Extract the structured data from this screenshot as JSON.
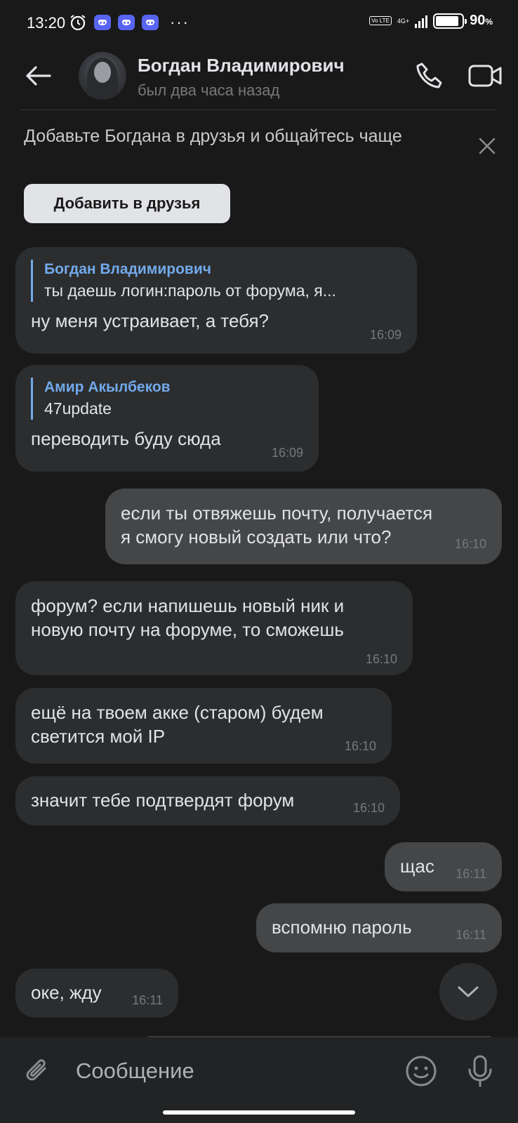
{
  "status_bar": {
    "time": "13:20",
    "battery_percent_label": "90",
    "battery_percent_sign": "%",
    "battery_level": 0.9,
    "network_label": "4G+",
    "volte_label": "Vo LTE",
    "icons": [
      "alarm-icon",
      "discord-icon",
      "discord-icon",
      "discord-icon",
      "more-dots-icon",
      "signal-icon",
      "battery-icon"
    ]
  },
  "header": {
    "contact_name": "Богдан Владимирович",
    "last_seen": "был два часа назад",
    "icons": [
      "back-arrow-icon",
      "phone-icon",
      "video-camera-icon"
    ]
  },
  "banner": {
    "text": "Добавьте Богдана в друзья и общайтесь чаще",
    "button_label": "Добавить в друзья"
  },
  "messages": [
    {
      "direction": "in",
      "reply_to": {
        "name": "Богдан Владимирович",
        "text": "ты даешь логин:пароль от форума, я..."
      },
      "text": "ну меня устраивает, а тебя?",
      "time": "16:09"
    },
    {
      "direction": "in",
      "reply_to": {
        "name": "Амир Акылбеков",
        "text": "47update"
      },
      "text": "переводить буду сюда",
      "time": "16:09"
    },
    {
      "direction": "out",
      "lines": [
        "если ты отвяжешь почту, получается",
        "я смогу новый создать или что?"
      ],
      "time": "16:10"
    },
    {
      "direction": "in",
      "lines": [
        "форум? если напишешь новый ник и",
        "новую почту на форуме, то сможешь"
      ],
      "time": "16:10"
    },
    {
      "direction": "in",
      "lines": [
        "ещё на твоем акке (старом) будем",
        "светится мой IP"
      ],
      "time": "16:10"
    },
    {
      "direction": "in",
      "text": "значит тебе подтвердят форум",
      "time": "16:10"
    },
    {
      "direction": "out",
      "text": "щас",
      "time": "16:11"
    },
    {
      "direction": "out",
      "text": "вспомню пароль",
      "time": "16:11"
    },
    {
      "direction": "in",
      "text": "оке, жду",
      "time": "16:11"
    }
  ],
  "composer": {
    "placeholder": "Сообщение",
    "icons": [
      "paperclip-icon",
      "emoji-icon",
      "microphone-icon"
    ]
  },
  "colors": {
    "background": "#19191a",
    "incoming_bubble": "#2c2d2e",
    "outgoing_bubble": "#454647",
    "accent": "#71aaeb",
    "discord": "#5865f2"
  }
}
